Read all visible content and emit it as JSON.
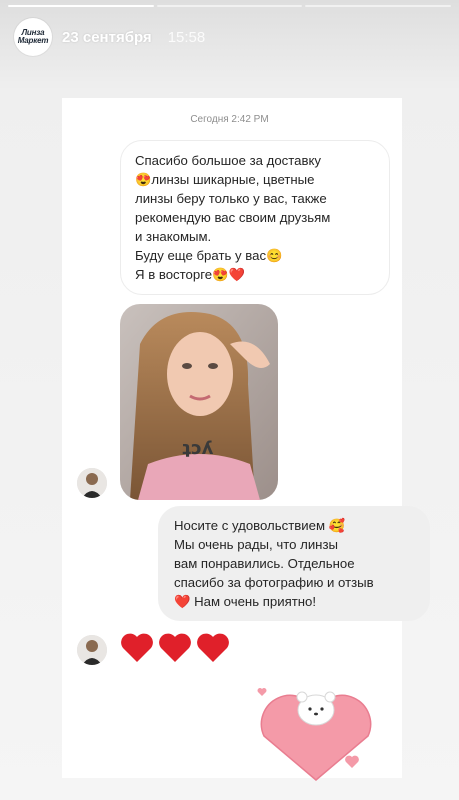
{
  "story": {
    "progress": {
      "segments": 3,
      "active_index": 0
    },
    "account_logo": {
      "line1": "Линза",
      "line2": "Маркет"
    },
    "date": "23 сентября",
    "time": "15:58"
  },
  "chat": {
    "timestamp": "Сегодня 2:42 PM",
    "incoming_message": {
      "lines": [
        "Спасибо большое за доставку",
        "😍линзы шикарные, цветные",
        "линзы беру только у вас, также",
        "рекомендую вас своим друзьям",
        "и знакомым.",
        "Буду еще брать у вас😊",
        "Я в восторге😍❤️"
      ]
    },
    "outgoing_message": {
      "lines": [
        "Носите с удовольствием 🥰",
        "Мы очень рады, что линзы",
        "вам понравились. Отдельное",
        "спасибо за фотографию и отзыв",
        "❤️ Нам очень приятно!"
      ]
    },
    "reaction": "❤️❤️❤️",
    "colors": {
      "heart": "#e0202a",
      "outgoing_bubble": "#efefef",
      "sticker_heart": "#f49aa8"
    }
  }
}
